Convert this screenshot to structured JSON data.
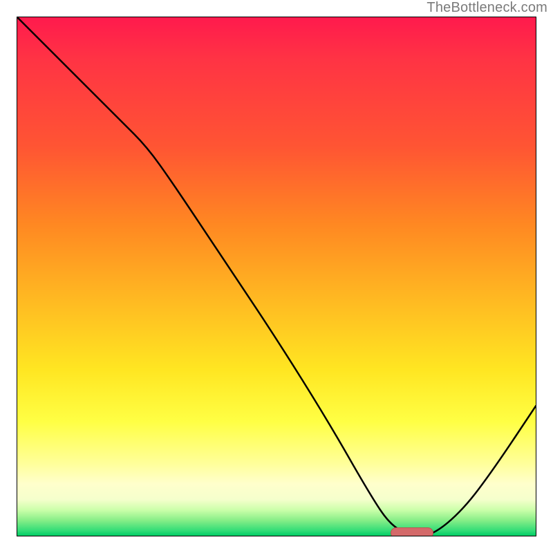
{
  "watermark": "TheBottleneck.com",
  "chart_data": {
    "type": "line",
    "title": "",
    "xlabel": "",
    "ylabel": "",
    "xlim": [
      0,
      100
    ],
    "ylim": [
      0,
      100
    ],
    "x": [
      0,
      10,
      20,
      25,
      30,
      40,
      50,
      60,
      68,
      72,
      76,
      80,
      86,
      92,
      100
    ],
    "values": [
      100,
      90,
      80,
      75,
      68,
      53,
      38,
      22,
      8,
      2,
      0,
      0,
      5,
      13,
      25
    ],
    "marker": {
      "x_start": 72,
      "x_end": 80,
      "y": 0
    },
    "colors": {
      "top": "#ff1a4d",
      "mid": "#ffe622",
      "bottom": "#00cc66",
      "curve": "#000000",
      "marker": "#d46a6a"
    }
  }
}
